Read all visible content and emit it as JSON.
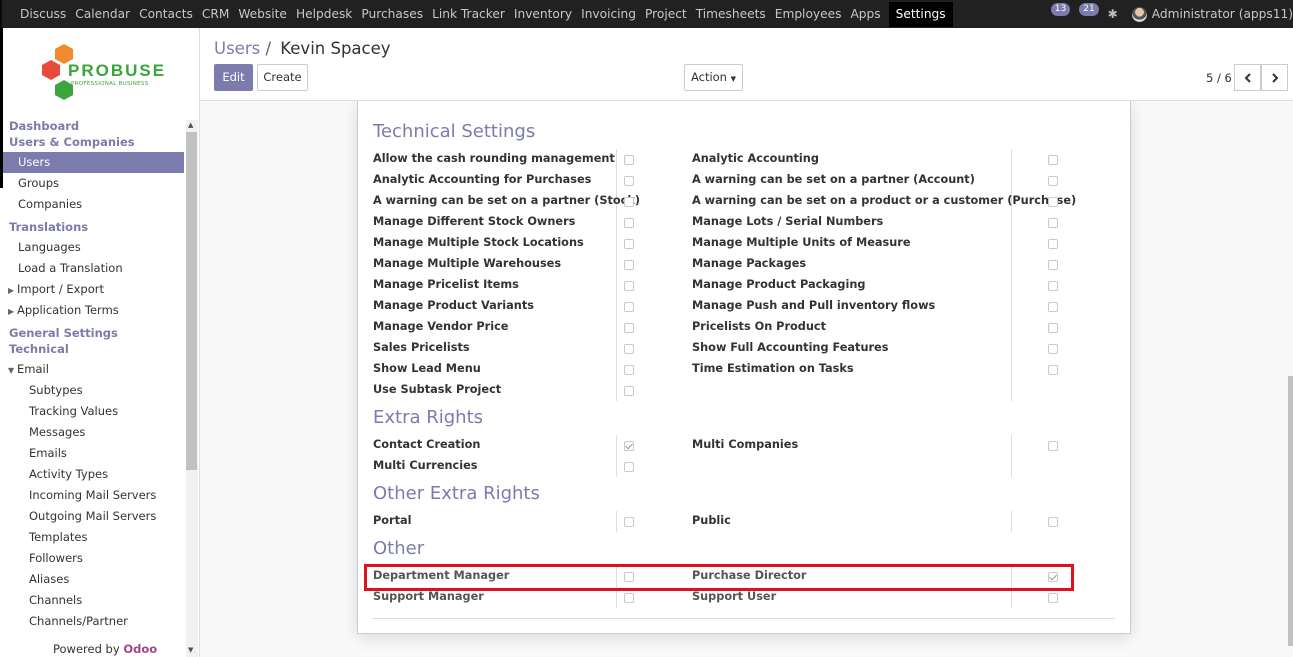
{
  "topbar": {
    "menu": [
      "Discuss",
      "Calendar",
      "Contacts",
      "CRM",
      "Website",
      "Helpdesk",
      "Purchases",
      "Link Tracker",
      "Inventory",
      "Invoicing",
      "Project",
      "Timesheets",
      "Employees",
      "Apps"
    ],
    "active": "Settings",
    "activity_count": "13",
    "message_count": "21",
    "user": "Administrator (apps11)"
  },
  "logo": {
    "name": "PROBUSE",
    "tagline": "PROFESSIONAL BUSINESS"
  },
  "sidebar": {
    "dashboard": "Dashboard",
    "users_companies": "Users & Companies",
    "users": "Users",
    "groups": "Groups",
    "companies": "Companies",
    "translations": "Translations",
    "languages": "Languages",
    "load_translation": "Load a Translation",
    "import_export": "Import / Export",
    "application_terms": "Application Terms",
    "general_settings": "General Settings",
    "technical": "Technical",
    "email": "Email",
    "email_items": [
      "Subtypes",
      "Tracking Values",
      "Messages",
      "Emails",
      "Activity Types",
      "Incoming Mail Servers",
      "Outgoing Mail Servers",
      "Templates",
      "Followers",
      "Aliases",
      "Channels",
      "Channels/Partner"
    ],
    "powered_by": "Powered by",
    "odoo": "Odoo"
  },
  "control_panel": {
    "breadcrumb_parent": "Users",
    "breadcrumb_sep": "/",
    "breadcrumb_current": "Kevin Spacey",
    "edit": "Edit",
    "create": "Create",
    "action": "Action",
    "pager": "5 / 6"
  },
  "sections": {
    "technical": {
      "title": "Technical Settings",
      "left": [
        {
          "label": "Allow the cash rounding management",
          "checked": false
        },
        {
          "label": "Analytic Accounting for Purchases",
          "checked": false
        },
        {
          "label": "A warning can be set on a partner (Stock)",
          "checked": false
        },
        {
          "label": "Manage Different Stock Owners",
          "checked": false
        },
        {
          "label": "Manage Multiple Stock Locations",
          "checked": false
        },
        {
          "label": "Manage Multiple Warehouses",
          "checked": false
        },
        {
          "label": "Manage Pricelist Items",
          "checked": false
        },
        {
          "label": "Manage Product Variants",
          "checked": false
        },
        {
          "label": "Manage Vendor Price",
          "checked": false
        },
        {
          "label": "Sales Pricelists",
          "checked": false
        },
        {
          "label": "Show Lead Menu",
          "checked": false
        },
        {
          "label": "Use Subtask Project",
          "checked": false
        }
      ],
      "right": [
        {
          "label": "Analytic Accounting",
          "checked": false
        },
        {
          "label": "A warning can be set on a partner (Account)",
          "checked": false
        },
        {
          "label": "A warning can be set on a product or a customer (Purchase)",
          "checked": false
        },
        {
          "label": "Manage Lots / Serial Numbers",
          "checked": false
        },
        {
          "label": "Manage Multiple Units of Measure",
          "checked": false
        },
        {
          "label": "Manage Packages",
          "checked": false
        },
        {
          "label": "Manage Product Packaging",
          "checked": false
        },
        {
          "label": "Manage Push and Pull inventory flows",
          "checked": false
        },
        {
          "label": "Pricelists On Product",
          "checked": false
        },
        {
          "label": "Show Full Accounting Features",
          "checked": false
        },
        {
          "label": "Time Estimation on Tasks",
          "checked": false
        }
      ]
    },
    "extra": {
      "title": "Extra Rights",
      "left": [
        {
          "label": "Contact Creation",
          "checked": true
        },
        {
          "label": "Multi Currencies",
          "checked": false
        }
      ],
      "right": [
        {
          "label": "Multi Companies",
          "checked": false
        }
      ]
    },
    "other_extra": {
      "title": "Other Extra Rights",
      "left": [
        {
          "label": "Portal",
          "checked": false
        }
      ],
      "right": [
        {
          "label": "Public",
          "checked": false
        }
      ]
    },
    "other": {
      "title": "Other",
      "left": [
        {
          "label": "Department Manager",
          "checked": false
        },
        {
          "label": "Support Manager",
          "checked": false
        }
      ],
      "right": [
        {
          "label": "Purchase Director",
          "checked": true
        },
        {
          "label": "Support User",
          "checked": false
        }
      ]
    }
  },
  "colors": {
    "accent": "#7c7bad",
    "highlight": "#e0101e",
    "topbar": "#212121"
  }
}
